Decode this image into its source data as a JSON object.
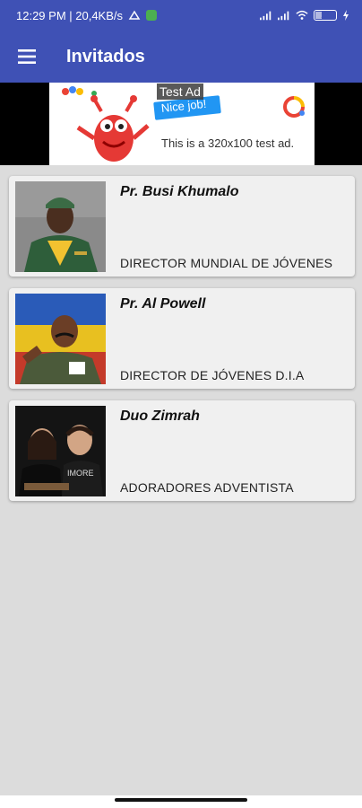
{
  "status_bar": {
    "time_info": "12:29 PM | 20,4KB/s",
    "battery": "22"
  },
  "app_bar": {
    "title": "Invitados",
    "menu_icon": "hamburger-menu-icon"
  },
  "ad": {
    "label": "Test Ad",
    "nice_text": "Nice job!",
    "text": "This is a 320x100 test ad."
  },
  "guests": [
    {
      "name": "Pr. Busi Khumalo",
      "role": "DIRECTOR MUNDIAL DE JÓVENES"
    },
    {
      "name": "Pr. Al Powell",
      "role": "DIRECTOR DE JÓVENES D.I.A"
    },
    {
      "name": "Duo Zimrah",
      "role": "ADORADORES ADVENTISTA"
    }
  ],
  "colors": {
    "primary": "#3f51b5",
    "background": "#dcdcdc",
    "card": "#f0f0f0"
  }
}
